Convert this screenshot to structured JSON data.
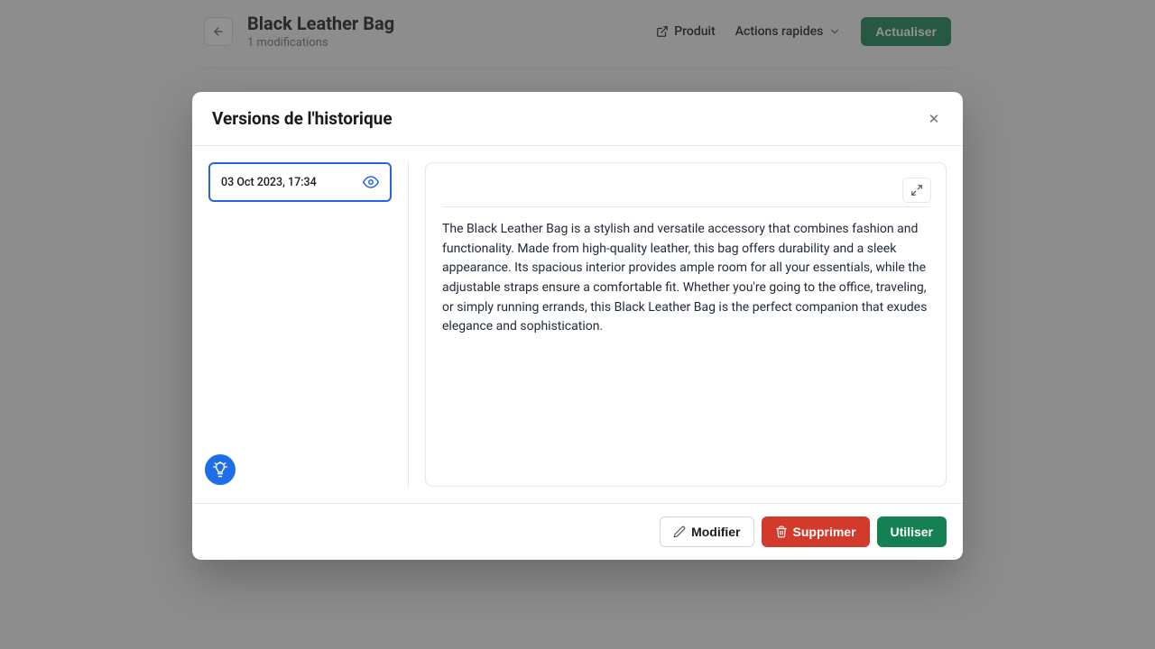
{
  "header": {
    "title": "Black Leather Bag",
    "subtitle": "1 modifications",
    "product_link": "Produit",
    "quick_actions": "Actions rapides",
    "update": "Actualiser"
  },
  "modal": {
    "title": "Versions de l'historique",
    "versions": [
      {
        "date": "03 Oct 2023, 17:34"
      }
    ],
    "content": "The Black Leather Bag is a stylish and versatile accessory that combines fashion and functionality. Made from high-quality leather, this bag offers durability and a sleek appearance. Its spacious interior provides ample room for all your essentials, while the adjustable straps ensure a comfortable fit. Whether you're going to the office, traveling, or simply running errands, this Black Leather Bag is the perfect companion that exudes elegance and sophistication.",
    "footer": {
      "modify": "Modifier",
      "delete": "Supprimer",
      "use": "Utiliser"
    }
  }
}
